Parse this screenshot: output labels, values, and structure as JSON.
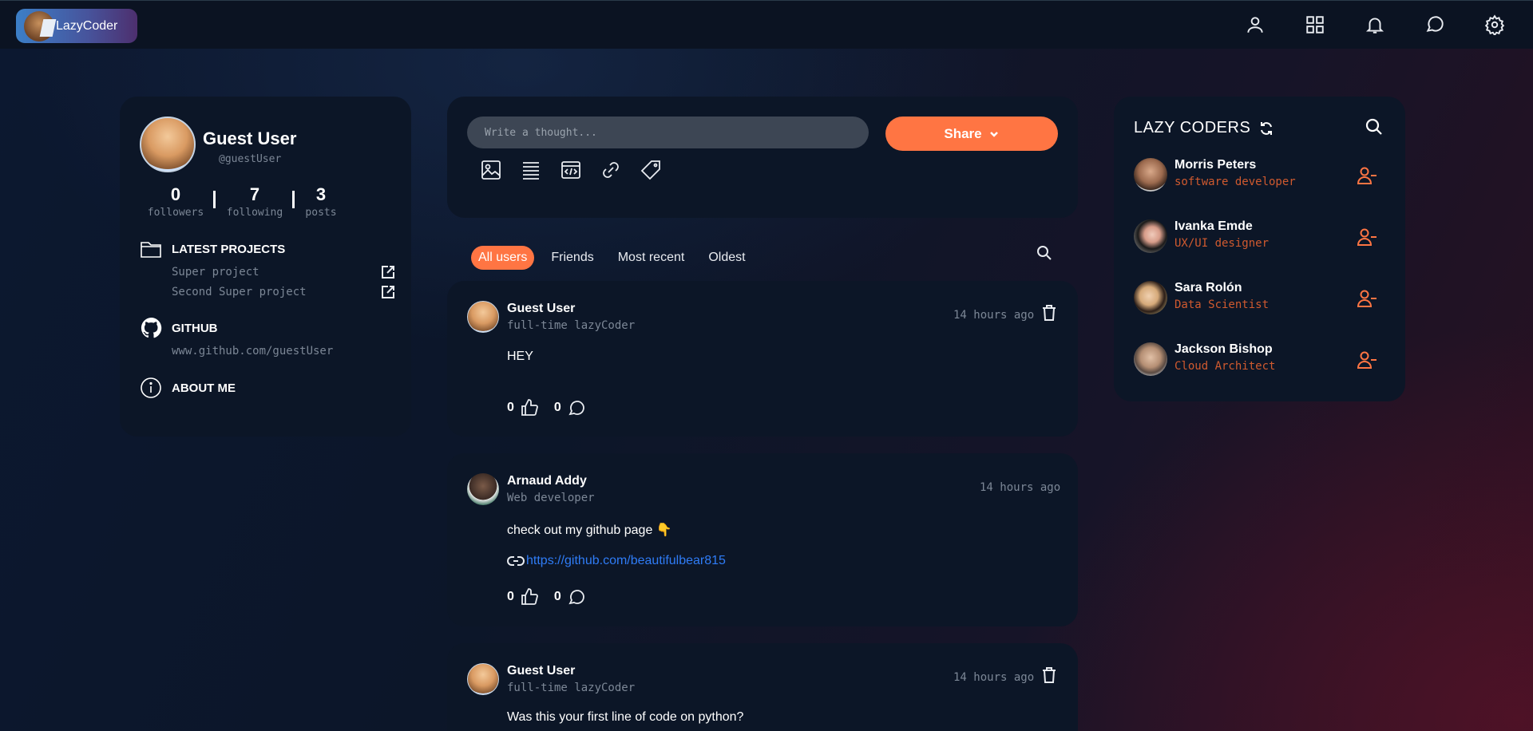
{
  "brand": {
    "name": "LazyCoder"
  },
  "nav": {
    "icons": [
      "user-icon",
      "grid-icon",
      "bell-icon",
      "chat-icon",
      "gear-icon"
    ]
  },
  "profile": {
    "name": "Guest User",
    "handle": "@guestUser",
    "stats": [
      {
        "value": "0",
        "label": "followers"
      },
      {
        "value": "7",
        "label": "following"
      },
      {
        "value": "3",
        "label": "posts"
      }
    ],
    "projects_title": "LATEST PROJECTS",
    "projects": [
      "Super project",
      "Second Super project"
    ],
    "github_title": "GITHUB",
    "github_url": "www.github.com/guestUser",
    "about_title": "ABOUT ME"
  },
  "composer": {
    "placeholder": "Write a thought...",
    "share_label": "Share",
    "tools": [
      "image-icon",
      "list-icon",
      "code-icon",
      "link-icon",
      "tag-icon"
    ]
  },
  "filters": [
    "All users",
    "Friends",
    "Most recent",
    "Oldest"
  ],
  "active_filter": "All users",
  "posts": [
    {
      "author": "Guest User",
      "role": "full-time lazyCoder",
      "time": "14 hours ago",
      "body": "HEY",
      "likes": "0",
      "comments": "0",
      "deletable": true
    },
    {
      "author": "Arnaud Addy",
      "role": "Web developer",
      "time": "14 hours ago",
      "body": "check out my github page 👇",
      "link": "https://github.com/beautifulbear815",
      "likes": "0",
      "comments": "0",
      "deletable": false
    },
    {
      "author": "Guest User",
      "role": "full-time lazyCoder",
      "time": "14 hours ago",
      "body": "Was this your first line of code on python?",
      "deletable": true
    }
  ],
  "coders": {
    "title": "LAZY CODERS",
    "list": [
      {
        "name": "Morris Peters",
        "role": "software developer"
      },
      {
        "name": "Ivanka Emde",
        "role": "UX/UI designer"
      },
      {
        "name": "Sara Rolón",
        "role": "Data Scientist"
      },
      {
        "name": "Jackson Bishop",
        "role": "Cloud Architect"
      }
    ]
  },
  "colors": {
    "accent": "#ff7543",
    "card": "#0c1627",
    "link": "#2f7cf6",
    "muted": "#7c8796"
  }
}
